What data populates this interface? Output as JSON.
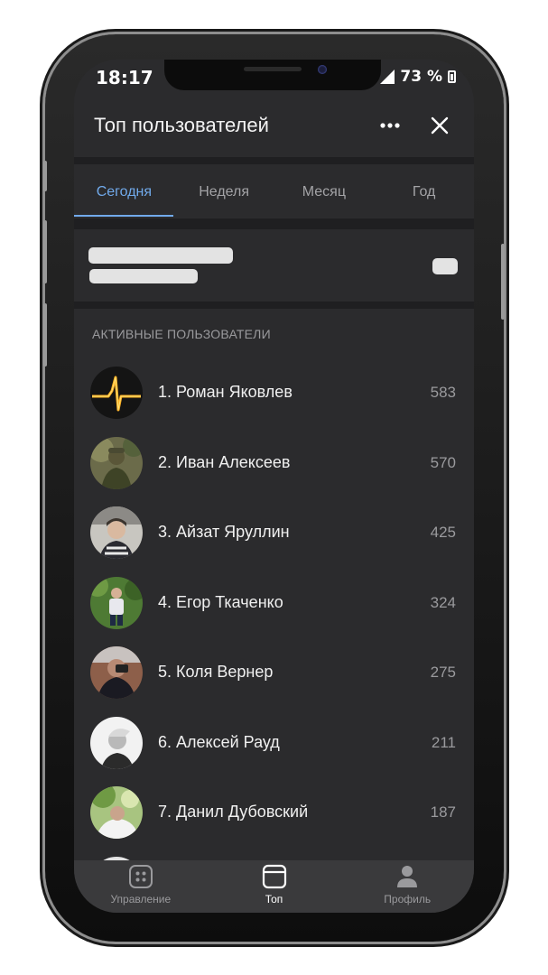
{
  "status_bar": {
    "time": "18:17",
    "battery": "73 %"
  },
  "header": {
    "title": "Топ пользователей",
    "more_icon": "more-horizontal-icon",
    "close_icon": "close-icon"
  },
  "tabs": [
    {
      "label": "Сегодня",
      "active": true
    },
    {
      "label": "Неделя",
      "active": false
    },
    {
      "label": "Месяц",
      "active": false
    },
    {
      "label": "Год",
      "active": false
    }
  ],
  "section": {
    "title": "АКТИВНЫЕ ПОЛЬЗОВАТЕЛИ"
  },
  "users": [
    {
      "name": "1. Роман Яковлев",
      "score": "583"
    },
    {
      "name": "2. Иван Алексеев",
      "score": "570"
    },
    {
      "name": "3. Айзат Яруллин",
      "score": "425"
    },
    {
      "name": "4. Егор Ткаченко",
      "score": "324"
    },
    {
      "name": "5. Коля Вернер",
      "score": "275"
    },
    {
      "name": "6. Алексей Рауд",
      "score": "211"
    },
    {
      "name": "7. Данил Дубовский",
      "score": "187"
    }
  ],
  "tabbar": [
    {
      "label": "Управление",
      "icon": "grid-icon",
      "active": false
    },
    {
      "label": "Топ",
      "icon": "window-icon",
      "active": true
    },
    {
      "label": "Профиль",
      "icon": "user-icon",
      "active": false
    }
  ],
  "colors": {
    "accent": "#71aaeb",
    "background": "#2b2b2d",
    "tabbar": "#3a3a3c"
  }
}
